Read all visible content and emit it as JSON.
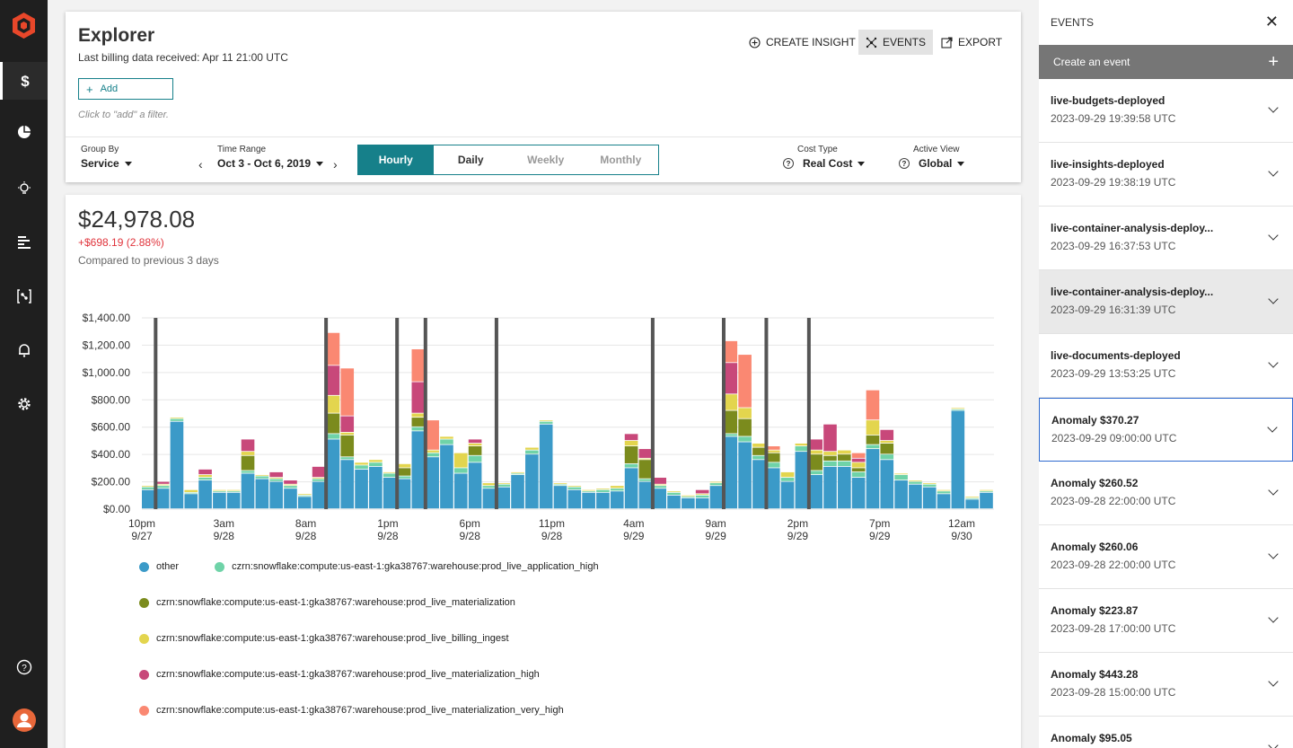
{
  "app": {
    "brand_color": "#e8472a",
    "accent_color": "#16808a",
    "nav_items": [
      {
        "name": "billing",
        "icon": "dollar-icon"
      },
      {
        "name": "reports",
        "icon": "pie-chart-icon"
      },
      {
        "name": "insights",
        "icon": "lightbulb-icon"
      },
      {
        "name": "allocation",
        "icon": "list-bars-icon"
      },
      {
        "name": "integrations",
        "icon": "bracket-node-icon"
      },
      {
        "name": "alerts",
        "icon": "bell-icon"
      },
      {
        "name": "settings",
        "icon": "gear-icon"
      }
    ]
  },
  "header": {
    "title": "Explorer",
    "billing_note": "Last billing data received: Apr 11 21:00 UTC",
    "add_label": "Add",
    "filter_hint": "Click to \"add\" a filter.",
    "actions": {
      "create_insight": "CREATE INSIGHT",
      "events": "EVENTS",
      "export": "EXPORT"
    }
  },
  "controls": {
    "group_by": {
      "label": "Group By",
      "value": "Service"
    },
    "time_range": {
      "label": "Time Range",
      "value": "Oct 3 - Oct 6, 2019"
    },
    "granularity": [
      "Hourly",
      "Daily",
      "Weekly",
      "Monthly"
    ],
    "granularity_selected": "Hourly",
    "cost_type": {
      "label": "Cost Type",
      "value": "Real Cost"
    },
    "active_view": {
      "label": "Active View",
      "value": "Global"
    }
  },
  "summary": {
    "total": "$24,978.08",
    "delta": "+$698.19 (2.88%)",
    "compare_note": "Compared to previous 3 days"
  },
  "chart_data": {
    "type": "bar",
    "stacked": true,
    "ylim": [
      0,
      1400
    ],
    "yticks": [
      "$0.00",
      "$200.00",
      "$400.00",
      "$600.00",
      "$800.00",
      "$1,000.00",
      "$1,200.00",
      "$1,400.00"
    ],
    "xticks": [
      [
        "10pm",
        "9/27"
      ],
      [
        "3am",
        "9/28"
      ],
      [
        "8am",
        "9/28"
      ],
      [
        "1pm",
        "9/28"
      ],
      [
        "6pm",
        "9/28"
      ],
      [
        "11pm",
        "9/28"
      ],
      [
        "4am",
        "9/29"
      ],
      [
        "9am",
        "9/29"
      ],
      [
        "2pm",
        "9/29"
      ],
      [
        "7pm",
        "9/29"
      ],
      [
        "12am",
        "9/30"
      ]
    ],
    "grid": true,
    "event_marker_indices": [
      0,
      12,
      17,
      19,
      24,
      35,
      40,
      43,
      46
    ],
    "series": [
      {
        "name": "other",
        "color": "#3b9ac8",
        "values": [
          140,
          150,
          640,
          110,
          210,
          120,
          120,
          260,
          220,
          200,
          150,
          90,
          200,
          510,
          360,
          290,
          310,
          230,
          220,
          570,
          380,
          470,
          260,
          340,
          150,
          160,
          250,
          400,
          620,
          170,
          140,
          120,
          120,
          130,
          300,
          200,
          150,
          100,
          80,
          80,
          170,
          530,
          490,
          360,
          300,
          200,
          420,
          250,
          310,
          310,
          230,
          440,
          360,
          210,
          180,
          160,
          110,
          720,
          70,
          120
        ]
      },
      {
        "name": "czrn:snowflake:compute:us-east-1:gka38767:warehouse:prod_live_application_high",
        "color": "#6fd3a8",
        "values": [
          20,
          20,
          20,
          10,
          20,
          10,
          10,
          20,
          20,
          20,
          20,
          10,
          20,
          40,
          20,
          30,
          30,
          30,
          20,
          30,
          30,
          40,
          40,
          50,
          20,
          20,
          10,
          30,
          20,
          10,
          20,
          10,
          20,
          20,
          30,
          20,
          20,
          20,
          10,
          20,
          20,
          20,
          40,
          30,
          40,
          30,
          40,
          30,
          40,
          40,
          40,
          30,
          40,
          40,
          20,
          20,
          20,
          10,
          10,
          10
        ]
      },
      {
        "name": "czrn:snowflake:compute:us-east-1:gka38767:warehouse:prod_live_materialization",
        "color": "#7b8b1d",
        "values": [
          0,
          0,
          0,
          0,
          0,
          0,
          0,
          110,
          0,
          0,
          0,
          0,
          0,
          150,
          160,
          0,
          0,
          0,
          60,
          70,
          0,
          0,
          0,
          70,
          0,
          0,
          0,
          0,
          0,
          0,
          0,
          0,
          0,
          0,
          130,
          140,
          0,
          0,
          0,
          0,
          0,
          170,
          130,
          60,
          70,
          0,
          0,
          120,
          40,
          50,
          30,
          70,
          80,
          0,
          0,
          0,
          0,
          0,
          0,
          0
        ]
      },
      {
        "name": "czrn:snowflake:compute:us-east-1:gka38767:warehouse:prod_live_billing_ingest",
        "color": "#e3d54e",
        "values": [
          10,
          10,
          10,
          20,
          20,
          10,
          10,
          30,
          10,
          10,
          10,
          10,
          10,
          130,
          20,
          20,
          20,
          10,
          30,
          30,
          20,
          20,
          110,
          20,
          20,
          10,
          10,
          20,
          10,
          10,
          10,
          10,
          10,
          20,
          40,
          10,
          10,
          10,
          10,
          10,
          10,
          120,
          80,
          30,
          20,
          40,
          20,
          30,
          30,
          30,
          40,
          110,
          20,
          10,
          10,
          10,
          10,
          10,
          10,
          10
        ]
      },
      {
        "name": "czrn:snowflake:compute:us-east-1:gka38767:warehouse:prod_live_materialization_high",
        "color": "#c8487a",
        "values": [
          0,
          20,
          0,
          0,
          40,
          0,
          0,
          90,
          0,
          40,
          30,
          0,
          80,
          220,
          120,
          0,
          0,
          0,
          0,
          230,
          0,
          0,
          0,
          30,
          0,
          0,
          0,
          0,
          0,
          0,
          0,
          0,
          0,
          0,
          50,
          70,
          50,
          0,
          0,
          30,
          0,
          230,
          0,
          0,
          0,
          0,
          0,
          80,
          200,
          0,
          30,
          0,
          80,
          0,
          0,
          0,
          0,
          0,
          0,
          0
        ]
      },
      {
        "name": "czrn:snowflake:compute:us-east-1:gka38767:warehouse:prod_live_materialization_very_high",
        "color": "#fa8872",
        "values": [
          0,
          0,
          0,
          0,
          0,
          0,
          0,
          0,
          0,
          0,
          0,
          0,
          0,
          240,
          350,
          0,
          0,
          0,
          0,
          240,
          220,
          0,
          0,
          0,
          0,
          0,
          0,
          0,
          0,
          0,
          0,
          0,
          0,
          0,
          0,
          0,
          0,
          0,
          0,
          0,
          0,
          160,
          390,
          0,
          30,
          0,
          0,
          0,
          0,
          0,
          40,
          220,
          0,
          0,
          0,
          0,
          0,
          0,
          0,
          0
        ]
      }
    ]
  },
  "legend": [
    [
      "other",
      "czrn:snowflake:compute:us-east-1:gka38767:warehouse:prod_live_application_high"
    ],
    [
      "czrn:snowflake:compute:us-east-1:gka38767:warehouse:prod_live_materialization"
    ],
    [
      "czrn:snowflake:compute:us-east-1:gka38767:warehouse:prod_live_billing_ingest"
    ],
    [
      "czrn:snowflake:compute:us-east-1:gka38767:warehouse:prod_live_materialization_high"
    ],
    [
      "czrn:snowflake:compute:us-east-1:gka38767:warehouse:prod_live_materialization_very_high"
    ]
  ],
  "events_panel": {
    "title": "EVENTS",
    "create_label": "Create an event",
    "items": [
      {
        "name": "live-budgets-deployed",
        "time": "2023-09-29 19:39:58 UTC",
        "state": ""
      },
      {
        "name": "live-insights-deployed",
        "time": "2023-09-29 19:38:19 UTC",
        "state": ""
      },
      {
        "name": "live-container-analysis-deploy...",
        "time": "2023-09-29 16:37:53 UTC",
        "state": ""
      },
      {
        "name": "live-container-analysis-deploy...",
        "time": "2023-09-29 16:31:39 UTC",
        "state": "highlight"
      },
      {
        "name": "live-documents-deployed",
        "time": "2023-09-29 13:53:25 UTC",
        "state": ""
      },
      {
        "name": "Anomaly $370.27",
        "time": "2023-09-29 09:00:00 UTC",
        "state": "selected"
      },
      {
        "name": "Anomaly $260.52",
        "time": "2023-09-28 22:00:00 UTC",
        "state": ""
      },
      {
        "name": "Anomaly $260.06",
        "time": "2023-09-28 22:00:00 UTC",
        "state": ""
      },
      {
        "name": "Anomaly $223.87",
        "time": "2023-09-28 17:00:00 UTC",
        "state": ""
      },
      {
        "name": "Anomaly $443.28",
        "time": "2023-09-28 15:00:00 UTC",
        "state": ""
      },
      {
        "name": "Anomaly $95.05",
        "time": "",
        "state": ""
      }
    ]
  }
}
